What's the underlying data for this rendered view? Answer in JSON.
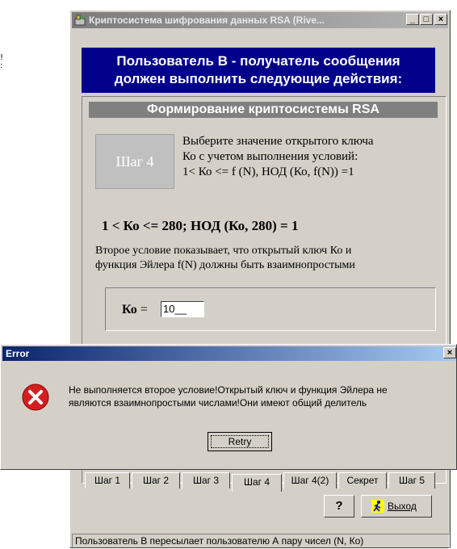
{
  "window": {
    "title": "Криптосистема шифрования данных RSA (Rive...",
    "min_glyph": "_",
    "max_glyph": "□",
    "close_glyph": "×"
  },
  "header": {
    "line1": "Пользователь В - получатель сообщения",
    "line2": "должен выполнить следующие действия:"
  },
  "section": {
    "title": "Формирование криптосистемы RSA"
  },
  "step": {
    "label": "Шаг 4",
    "instr_line1": "Выберите значение открытого ключа",
    "instr_line2": "Ко с учетом выполнения условий:",
    "instr_line3": "1< Ко <= f (N),  НОД (Ко, f(N)) =1"
  },
  "condition": "1 < Ко <= 280;   НОД (Ко, 280) = 1",
  "explanation": {
    "line1": "Второе условие показывает, что открытый ключ Ко и",
    "line2": "функция Эйлера f(N) должны быть взаимнопростыми"
  },
  "ko": {
    "label": "Ко",
    "eq": " =",
    "value": "10__"
  },
  "tabs": [
    {
      "label": "Шаг 1"
    },
    {
      "label": "Шаг 2"
    },
    {
      "label": "Шаг 3"
    },
    {
      "label": "Шаг 4"
    },
    {
      "label": "Шаг 4(2)"
    },
    {
      "label": "Секрет"
    },
    {
      "label": "Шаг 5"
    }
  ],
  "buttons": {
    "help": "?",
    "exit": "Выход"
  },
  "status": "Пользователь В пересылает пользователю А пару чисел (N, Ко)",
  "error": {
    "title": "Error",
    "close_glyph": "×",
    "message_line1": "Не выполняется второе условие!Открытый ключ и функция Эйлера не",
    "message_line2": "являются взаимнопростыми числами!Они имеют общий делитель",
    "retry": "Retry"
  },
  "edge_marks": [
    "!",
    ":"
  ],
  "colors": {
    "header_bg": "#00008b",
    "error_icon": "#d11f1f",
    "error_title": "#0a246a"
  }
}
